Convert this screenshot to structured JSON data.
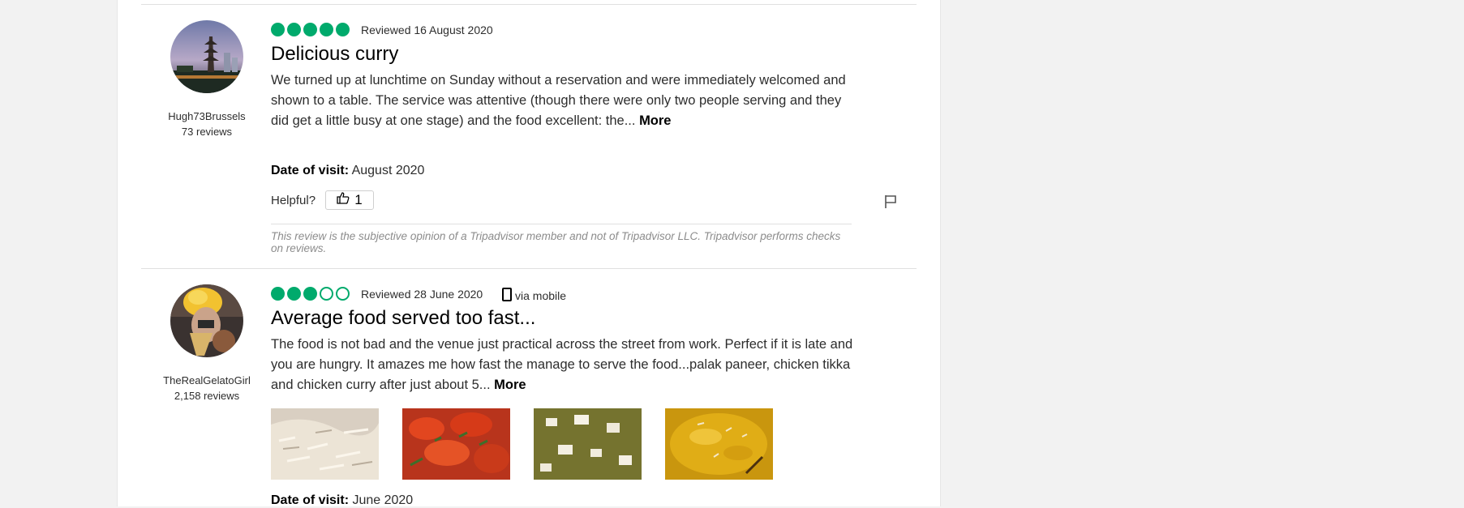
{
  "reviews": [
    {
      "username": "Hugh73Brussels",
      "review_count": "73 reviews",
      "rating": 5,
      "reviewed_date": "Reviewed 16 August 2020",
      "via": "",
      "title": "Delicious curry",
      "body": "We turned up at lunchtime on Sunday without a reservation and were immediately welcomed and shown to a table. The service was attentive (though there were only two people serving and they did get a little busy at one stage) and the food excellent: the...",
      "more_label": "More",
      "date_of_visit_label": "Date of visit:",
      "date_of_visit": "August 2020",
      "helpful_label": "Helpful?",
      "helpful_count": "1",
      "disclaimer": "This review is the subjective opinion of a Tripadvisor member and not of Tripadvisor LLC. Tripadvisor performs checks on reviews."
    },
    {
      "username": "TheRealGelatoGirl",
      "review_count": "2,158 reviews",
      "rating": 3,
      "reviewed_date": "Reviewed 28 June 2020",
      "via": "via mobile",
      "title": "Average food served too fast...",
      "body": "The food is not bad and the venue just practical across the street from work. Perfect if it is late and you are hungry. It amazes me how fast the manage to serve the food...palak paneer, chicken tikka and chicken curry after just about 5...",
      "more_label": "More",
      "date_of_visit_label": "Date of visit:",
      "date_of_visit": "June 2020",
      "photos": [
        "rice-photo",
        "chicken-tikka-photo",
        "palak-paneer-photo",
        "curry-photo"
      ]
    }
  ],
  "colors": {
    "rating_green": "#00aa6c",
    "divider": "#e0e0e0",
    "page_bg": "#f2f2f2"
  },
  "icons": {
    "helpful": "thumbs-up-icon",
    "report": "flag-icon",
    "mobile": "mobile-phone-icon"
  }
}
